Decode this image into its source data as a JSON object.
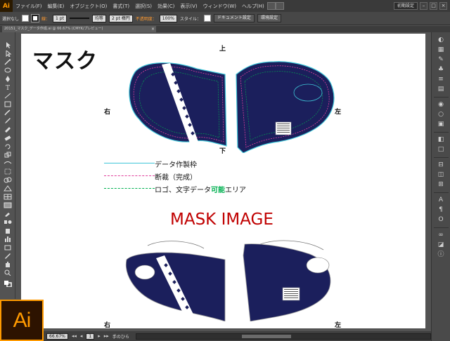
{
  "app": {
    "logo": "Ai",
    "big_logo": "Ai",
    "workspace": "初期設定",
    "colors": {
      "accent": "#ff9a00",
      "mask_navy": "#1b1f5c",
      "red_title": "#c00000",
      "legend_cyan": "#3ec6d8",
      "legend_magenta": "#e0409c",
      "legend_green": "#00b050"
    }
  },
  "menu": {
    "items": [
      "ファイル(F)",
      "編集(E)",
      "オブジェクト(O)",
      "書式(T)",
      "選択(S)",
      "効果(C)",
      "表示(V)",
      "ウィンドウ(W)",
      "ヘルプ(H)"
    ]
  },
  "control": {
    "selection": "選択なし",
    "stroke_label": "線：",
    "stroke_weight": "1 pt",
    "stroke_profile": "均等",
    "brush": "2 pt 楕円",
    "opacity_label": "不透明度：",
    "opacity_value": "100%",
    "style_label": "スタイル：",
    "doc_setup": "ドキュメント設定",
    "prefs": "環境設定"
  },
  "tab": {
    "name": "20151_マスク_データ作成.ai @ 66.67% (CMYK/プレビュー)",
    "close": "×"
  },
  "artboard": {
    "title": "マスク",
    "top_label": "上",
    "bottom_label": "下",
    "right_label": "右",
    "left_label": "左",
    "right_label_bottom": "右",
    "left_label_bottom": "左",
    "legend": [
      {
        "text": "データ作製枠",
        "color": "#3ec6d8",
        "style": "solid"
      },
      {
        "text": "断裁（完成）",
        "color": "#e0409c",
        "style": "dashed"
      },
      {
        "text_before": "ロゴ、文字データ",
        "text_highlight": "可能",
        "text_after": "エリア",
        "color": "#00b050",
        "style": "dashed"
      }
    ],
    "mask_image_title": "MASK IMAGE"
  },
  "status": {
    "zoom": "66.67%",
    "page": "1",
    "tool": "手のひら"
  },
  "right_panel_icons": [
    "color-icon",
    "swatches-icon",
    "brushes-icon",
    "symbols-icon",
    "stroke-icon",
    "gradient-icon",
    "transparency-icon",
    "appearance-icon",
    "graphic-styles-icon",
    "layers-icon",
    "artboards-icon",
    "align-icon",
    "pathfinder-icon",
    "transform-icon",
    "character-icon",
    "paragraph-icon",
    "opentype-icon",
    "links-icon",
    "navigator-icon",
    "info-icon"
  ]
}
